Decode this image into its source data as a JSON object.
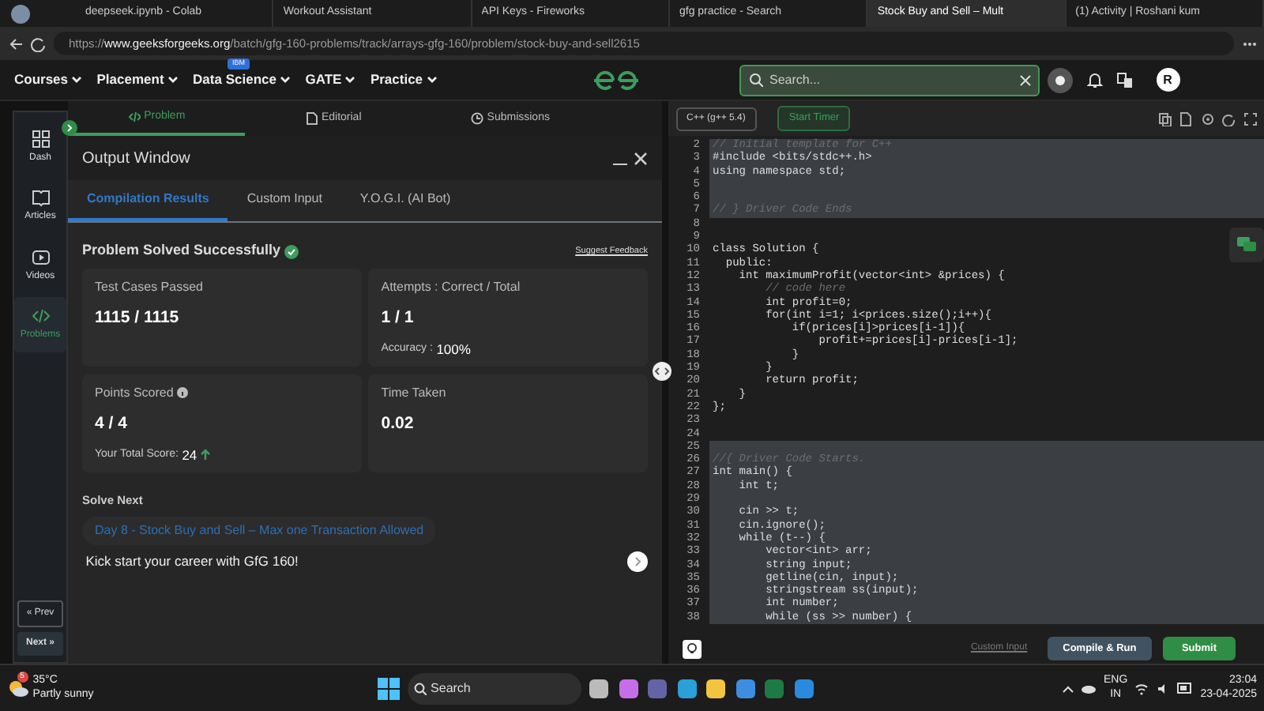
{
  "browser_tabs": [
    {
      "label": "deepseek.ipynb - Colab",
      "selected": false
    },
    {
      "label": "Workout Assistant",
      "selected": false
    },
    {
      "label": "API Keys - Fireworks",
      "selected": false
    },
    {
      "label": "gfg practice - Search",
      "selected": false
    },
    {
      "label": "Stock Buy and Sell – Mult",
      "selected": true
    },
    {
      "label": "(1) Activity | Roshani kum",
      "selected": false
    }
  ],
  "address_bar": {
    "url_prefix": "https://",
    "url_host": "www.geeksforgeeks.org",
    "url_path": "/batch/gfg-160-problems/track/arrays-gfg-160/problem/stock-buy-and-sell2615"
  },
  "site_nav": {
    "menus": [
      {
        "label": "Courses"
      },
      {
        "label": "Placement"
      },
      {
        "label": "Data Science",
        "badge": "IBM"
      },
      {
        "label": "GATE"
      },
      {
        "label": "Practice"
      }
    ],
    "search": {
      "placeholder": "Search..."
    },
    "avatar": "R"
  },
  "sidebar": {
    "items": [
      {
        "label": "Dash",
        "kind": "dash",
        "selected": false
      },
      {
        "label": "Articles",
        "kind": "articles",
        "selected": false
      },
      {
        "label": "Videos",
        "kind": "videos",
        "selected": false
      },
      {
        "label": "Problems",
        "kind": "code",
        "selected": true
      }
    ],
    "prev": "« Prev",
    "next": "Next »"
  },
  "problem_tabs": [
    {
      "label": "Problem",
      "kind": "code",
      "selected": true
    },
    {
      "label": "Editorial",
      "kind": "doc",
      "selected": false
    },
    {
      "label": "Submissions",
      "kind": "clock",
      "selected": false
    }
  ],
  "output_window": {
    "title": "Output Window",
    "tabs": [
      {
        "label": "Compilation Results",
        "selected": true
      },
      {
        "label": "Custom Input",
        "selected": false
      },
      {
        "label": "Y.O.G.I. (AI Bot)",
        "selected": false
      }
    ],
    "status": "Problem Solved Successfully",
    "feedback_link": "Suggest Feedback",
    "stats": [
      {
        "label": "Test Cases Passed",
        "value": "1115 / 1115"
      },
      {
        "label": "Attempts : Correct / Total",
        "value": "1 / 1",
        "note_label": "Accuracy :",
        "note_value": "100%"
      },
      {
        "label": "Points Scored",
        "value": "4 / 4",
        "info": true,
        "note_label": "Your Total Score:",
        "note_value": "24",
        "trend_up": true
      },
      {
        "label": "Time Taken",
        "value": "0.02"
      }
    ],
    "solve_next": {
      "heading": "Solve Next",
      "problem": "Day 8 - Stock Buy and Sell – Max one Transaction Allowed"
    },
    "promo": "Kick start your career with GfG 160!"
  },
  "editor": {
    "language": "C++ (g++ 5.4)",
    "timer": "Start Timer",
    "lines": [
      {
        "num": "2",
        "locked": true,
        "kind": "comment",
        "text": "// Initial template for C++"
      },
      {
        "num": "3",
        "locked": true,
        "kind": "code",
        "text": "#include <bits/stdc++.h>"
      },
      {
        "num": "4",
        "locked": true,
        "kind": "code",
        "text": "using namespace std;"
      },
      {
        "num": "5",
        "locked": true,
        "kind": "code"
      },
      {
        "num": "6",
        "locked": true,
        "kind": "code"
      },
      {
        "num": "7",
        "locked": true,
        "kind": "comment",
        "text": "// } Driver Code Ends"
      },
      {
        "num": "8",
        "locked": false,
        "kind": "code"
      },
      {
        "num": "9",
        "locked": false,
        "kind": "code"
      },
      {
        "num": "10",
        "locked": false,
        "kind": "code",
        "text": "class Solution {"
      },
      {
        "num": "11",
        "locked": false,
        "kind": "code",
        "text": "  public:"
      },
      {
        "num": "12",
        "locked": false,
        "kind": "code",
        "text": "    int maximumProfit(vector<int> &prices) {"
      },
      {
        "num": "13",
        "locked": false,
        "kind": "comment",
        "text": "        // code here"
      },
      {
        "num": "14",
        "locked": false,
        "kind": "code",
        "text": "        int profit=0;"
      },
      {
        "num": "15",
        "locked": false,
        "kind": "code",
        "text": "        for(int i=1; i<prices.size();i++){"
      },
      {
        "num": "16",
        "locked": false,
        "kind": "code",
        "text": "            if(prices[i]>prices[i-1]){"
      },
      {
        "num": "17",
        "locked": false,
        "kind": "code",
        "text": "                profit+=prices[i]-prices[i-1];"
      },
      {
        "num": "18",
        "locked": false,
        "kind": "code",
        "text": "            }"
      },
      {
        "num": "19",
        "locked": false,
        "kind": "code",
        "text": "        }"
      },
      {
        "num": "20",
        "locked": false,
        "kind": "code",
        "text": "        return profit;"
      },
      {
        "num": "21",
        "locked": false,
        "kind": "code",
        "text": "    }"
      },
      {
        "num": "22",
        "locked": false,
        "kind": "code",
        "text": "};"
      },
      {
        "num": "23",
        "locked": false,
        "kind": "code"
      },
      {
        "num": "24",
        "locked": false,
        "kind": "code"
      },
      {
        "num": "25",
        "locked": true,
        "kind": "code"
      },
      {
        "num": "26",
        "locked": true,
        "kind": "comment",
        "text": "//{ Driver Code Starts."
      },
      {
        "num": "27",
        "locked": true,
        "kind": "code",
        "text": "int main() {"
      },
      {
        "num": "28",
        "locked": true,
        "kind": "code",
        "text": "    int t;"
      },
      {
        "num": "29",
        "locked": true,
        "kind": "code"
      },
      {
        "num": "30",
        "locked": true,
        "kind": "code",
        "text": "    cin >> t;"
      },
      {
        "num": "31",
        "locked": true,
        "kind": "code",
        "text": "    cin.ignore();"
      },
      {
        "num": "32",
        "locked": true,
        "kind": "code",
        "text": "    while (t--) {"
      },
      {
        "num": "33",
        "locked": true,
        "kind": "code",
        "text": "        vector<int> arr;"
      },
      {
        "num": "34",
        "locked": true,
        "kind": "code",
        "text": "        string input;"
      },
      {
        "num": "35",
        "locked": true,
        "kind": "code",
        "text": "        getline(cin, input);"
      },
      {
        "num": "36",
        "locked": true,
        "kind": "code",
        "text": "        stringstream ss(input);"
      },
      {
        "num": "37",
        "locked": true,
        "kind": "code",
        "text": "        int number;"
      },
      {
        "num": "38",
        "locked": true,
        "kind": "code",
        "text": "        while (ss >> number) {"
      }
    ],
    "footer": {
      "custom_input": "Custom Input",
      "compile": "Compile & Run",
      "submit": "Submit"
    }
  },
  "taskbar": {
    "weather_temp": "35°C",
    "weather_text": "Partly sunny",
    "weather_badge": "5",
    "search": "Search",
    "lang": "ENG",
    "region": "IN",
    "time": "23:04",
    "date": "23-04-2025"
  }
}
